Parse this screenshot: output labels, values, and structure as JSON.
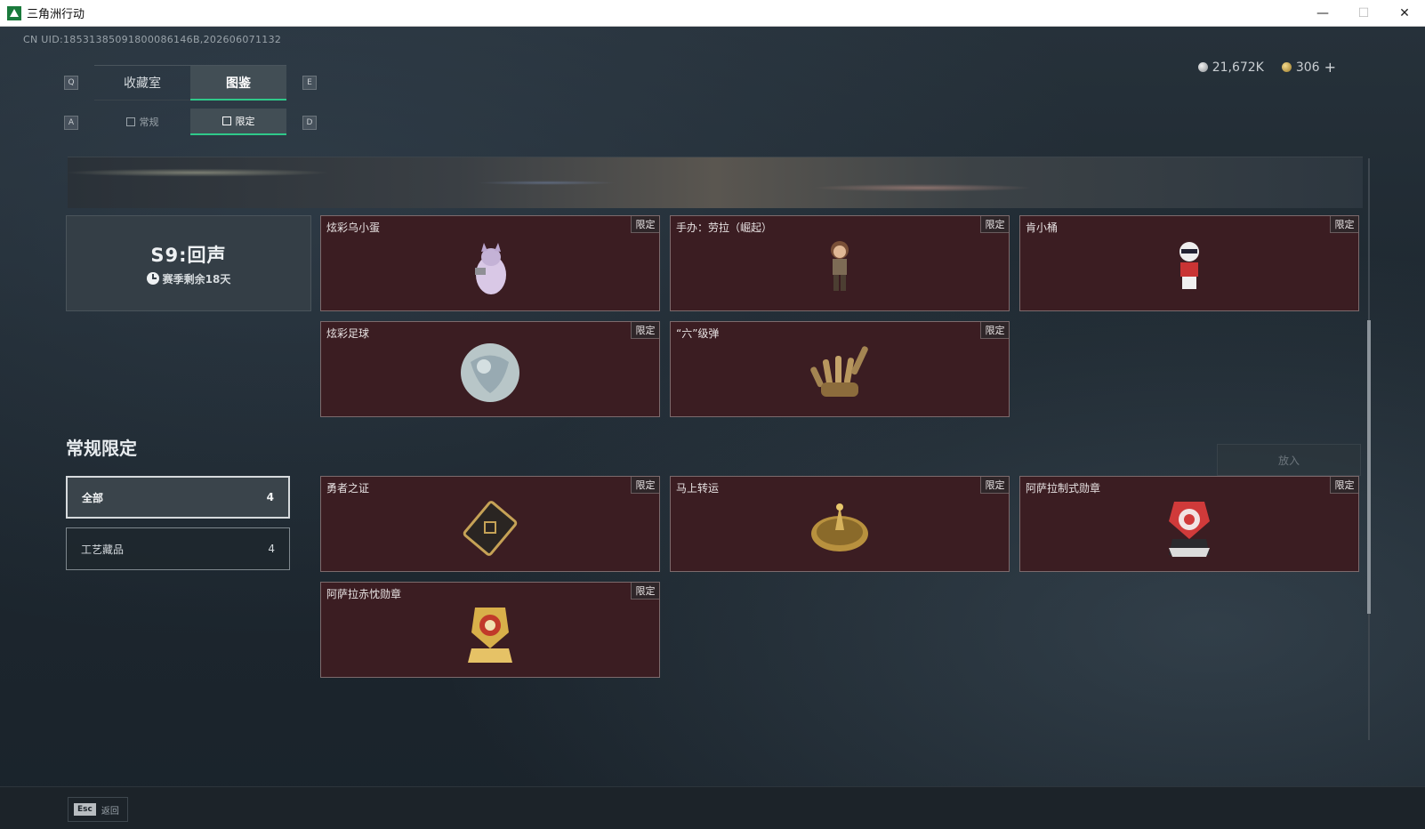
{
  "window": {
    "title": "三角洲行动",
    "minimize": "—",
    "maximize": "☐",
    "close": "✕"
  },
  "header": {
    "uid": "CN UID:18531385091800086146B,202606071132",
    "currency": [
      {
        "icon": "silver-coin-icon",
        "value": "21,672K"
      },
      {
        "icon": "gold-coin-icon",
        "value": "306"
      }
    ],
    "add_label": "+"
  },
  "tabs": {
    "prev_key": "Q",
    "next_key": "E",
    "items": [
      {
        "label": "收藏室",
        "active": false
      },
      {
        "label": "图鉴",
        "active": true
      }
    ]
  },
  "subtabs": {
    "prev_key": "A",
    "next_key": "D",
    "items": [
      {
        "label": "常规",
        "active": false
      },
      {
        "label": "限定",
        "active": true
      }
    ]
  },
  "season": {
    "title": "S9:回声",
    "remaining": "赛季剩余18天"
  },
  "season_items": [
    {
      "name": "炫彩乌小蛋",
      "badge": "限定",
      "icon": "egg-figure-icon"
    },
    {
      "name": "手办：劳拉（崛起）",
      "badge": "限定",
      "icon": "figure-lara-icon"
    },
    {
      "name": "肯小桶",
      "badge": "限定",
      "icon": "figure-bucket-icon"
    },
    {
      "name": "炫彩足球",
      "badge": "限定",
      "icon": "soccer-ball-icon"
    },
    {
      "name": "“六”级弹",
      "badge": "限定",
      "icon": "hand-bullets-icon"
    }
  ],
  "regular_section": {
    "title": "常规限定",
    "put_button": "放入",
    "filters": [
      {
        "label": "全部",
        "count": "4",
        "active": true
      },
      {
        "label": "工艺藏品",
        "count": "4",
        "active": false
      }
    ],
    "items": [
      {
        "name": "勇者之证",
        "badge": "限定",
        "icon": "card-token-icon"
      },
      {
        "name": "马上转运",
        "badge": "限定",
        "icon": "gold-disc-icon"
      },
      {
        "name": "阿萨拉制式勋章",
        "badge": "限定",
        "icon": "medal-red-icon"
      },
      {
        "name": "阿萨拉赤忱勋章",
        "badge": "限定",
        "icon": "medal-gold-icon"
      }
    ]
  },
  "footer": {
    "esc_key": "Esc",
    "back_label": "返回"
  },
  "colors": {
    "accent": "#2fc98a",
    "card_bg": "#3b1d22",
    "card_border": "#7c6a6c",
    "page_bg": "#1e2830"
  }
}
